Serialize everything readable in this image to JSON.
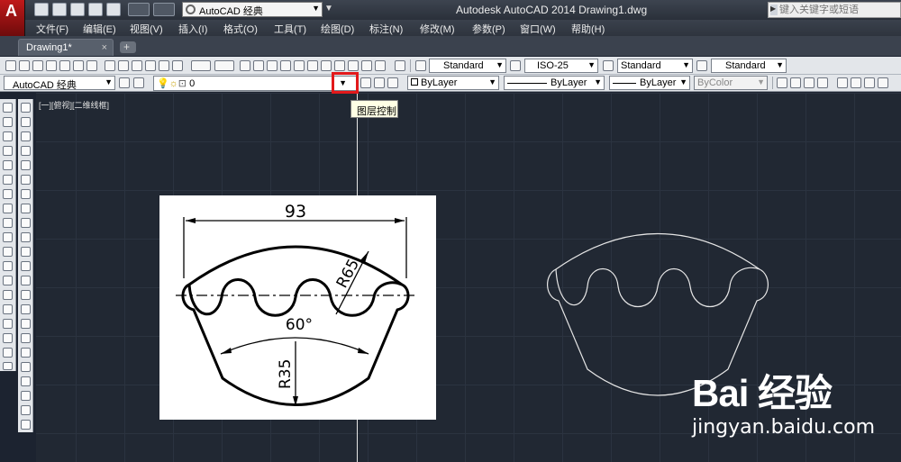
{
  "window": {
    "title": "Autodesk AutoCAD 2014    Drawing1.dwg",
    "app_letter": "A"
  },
  "quick_access": {
    "workspace": "AutoCAD 经典"
  },
  "search": {
    "placeholder": "键入关键字或短语"
  },
  "menus": [
    "文件(F)",
    "编辑(E)",
    "视图(V)",
    "插入(I)",
    "格式(O)",
    "工具(T)",
    "绘图(D)",
    "标注(N)",
    "修改(M)",
    "参数(P)",
    "窗口(W)",
    "帮助(H)"
  ],
  "tabs": {
    "doc_tab": "Drawing1*",
    "close_glyph": "×",
    "new_glyph": "+"
  },
  "styles": {
    "text_style": "Standard",
    "dim_style": "ISO-25",
    "table_style": "Standard",
    "mleader_style": "Standard"
  },
  "layers": {
    "workspace": "AutoCAD 经典",
    "current_layer": "0",
    "tooltip": "图层控制"
  },
  "properties": {
    "color": "ByLayer",
    "linetype": "ByLayer",
    "lineweight": "ByLayer",
    "plot_style": "ByColor"
  },
  "viewport": {
    "label": "[一][俯视][二维线框]"
  },
  "reference_drawing": {
    "dimension_width": "93",
    "radius_large": "R65",
    "angle": "60°",
    "radius_small": "R35"
  },
  "watermark": {
    "brand": "Bai  经验",
    "url": "jingyan.baidu.com"
  },
  "colors": {
    "highlight": "#e2191b",
    "canvas": "#212833",
    "drawing_line": "#e6e6e6"
  }
}
